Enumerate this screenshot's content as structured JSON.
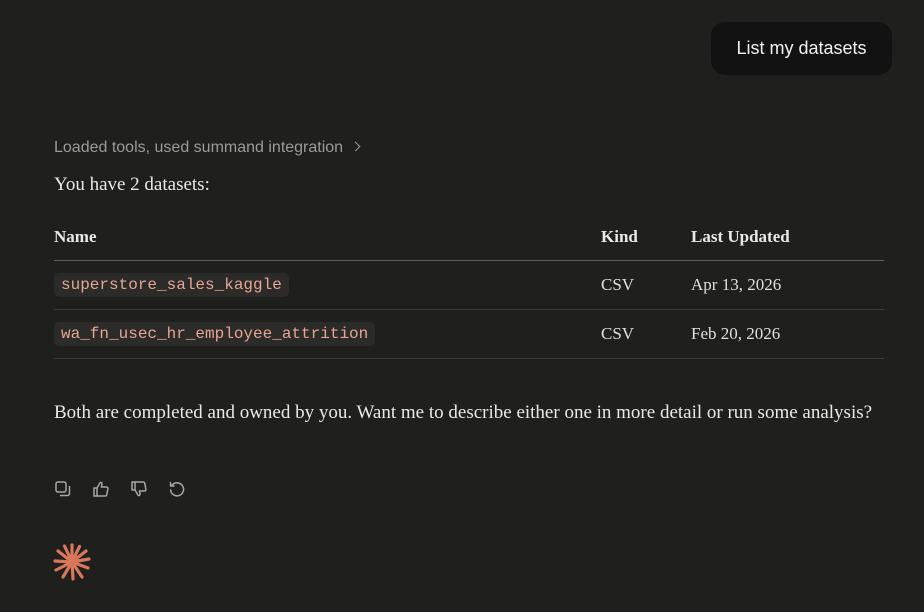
{
  "user_message": {
    "text": "List my datasets"
  },
  "assistant": {
    "tools_summary": "Loaded tools, used summand integration",
    "intro": "You have 2 datasets:",
    "table": {
      "headers": {
        "name": "Name",
        "kind": "Kind",
        "last_updated": "Last Updated"
      },
      "rows": [
        {
          "name": "superstore_sales_kaggle",
          "kind": "CSV",
          "last_updated": "Apr 13, 2026"
        },
        {
          "name": "wa_fn_usec_hr_employee_attrition",
          "kind": "CSV",
          "last_updated": "Feb 20, 2026"
        }
      ]
    },
    "outro": "Both are completed and owned by you. Want me to describe either one in more detail or run some analysis?",
    "actions": [
      {
        "icon": "copy-icon"
      },
      {
        "icon": "thumbs-up-icon"
      },
      {
        "icon": "thumbs-down-icon"
      },
      {
        "icon": "retry-icon"
      }
    ]
  },
  "colors": {
    "background": "#1f1f1e",
    "user_bubble": "#121212",
    "code_text": "#e8a592",
    "accent": "#d9775b"
  },
  "logo": {
    "icon": "claude-spark-icon"
  }
}
